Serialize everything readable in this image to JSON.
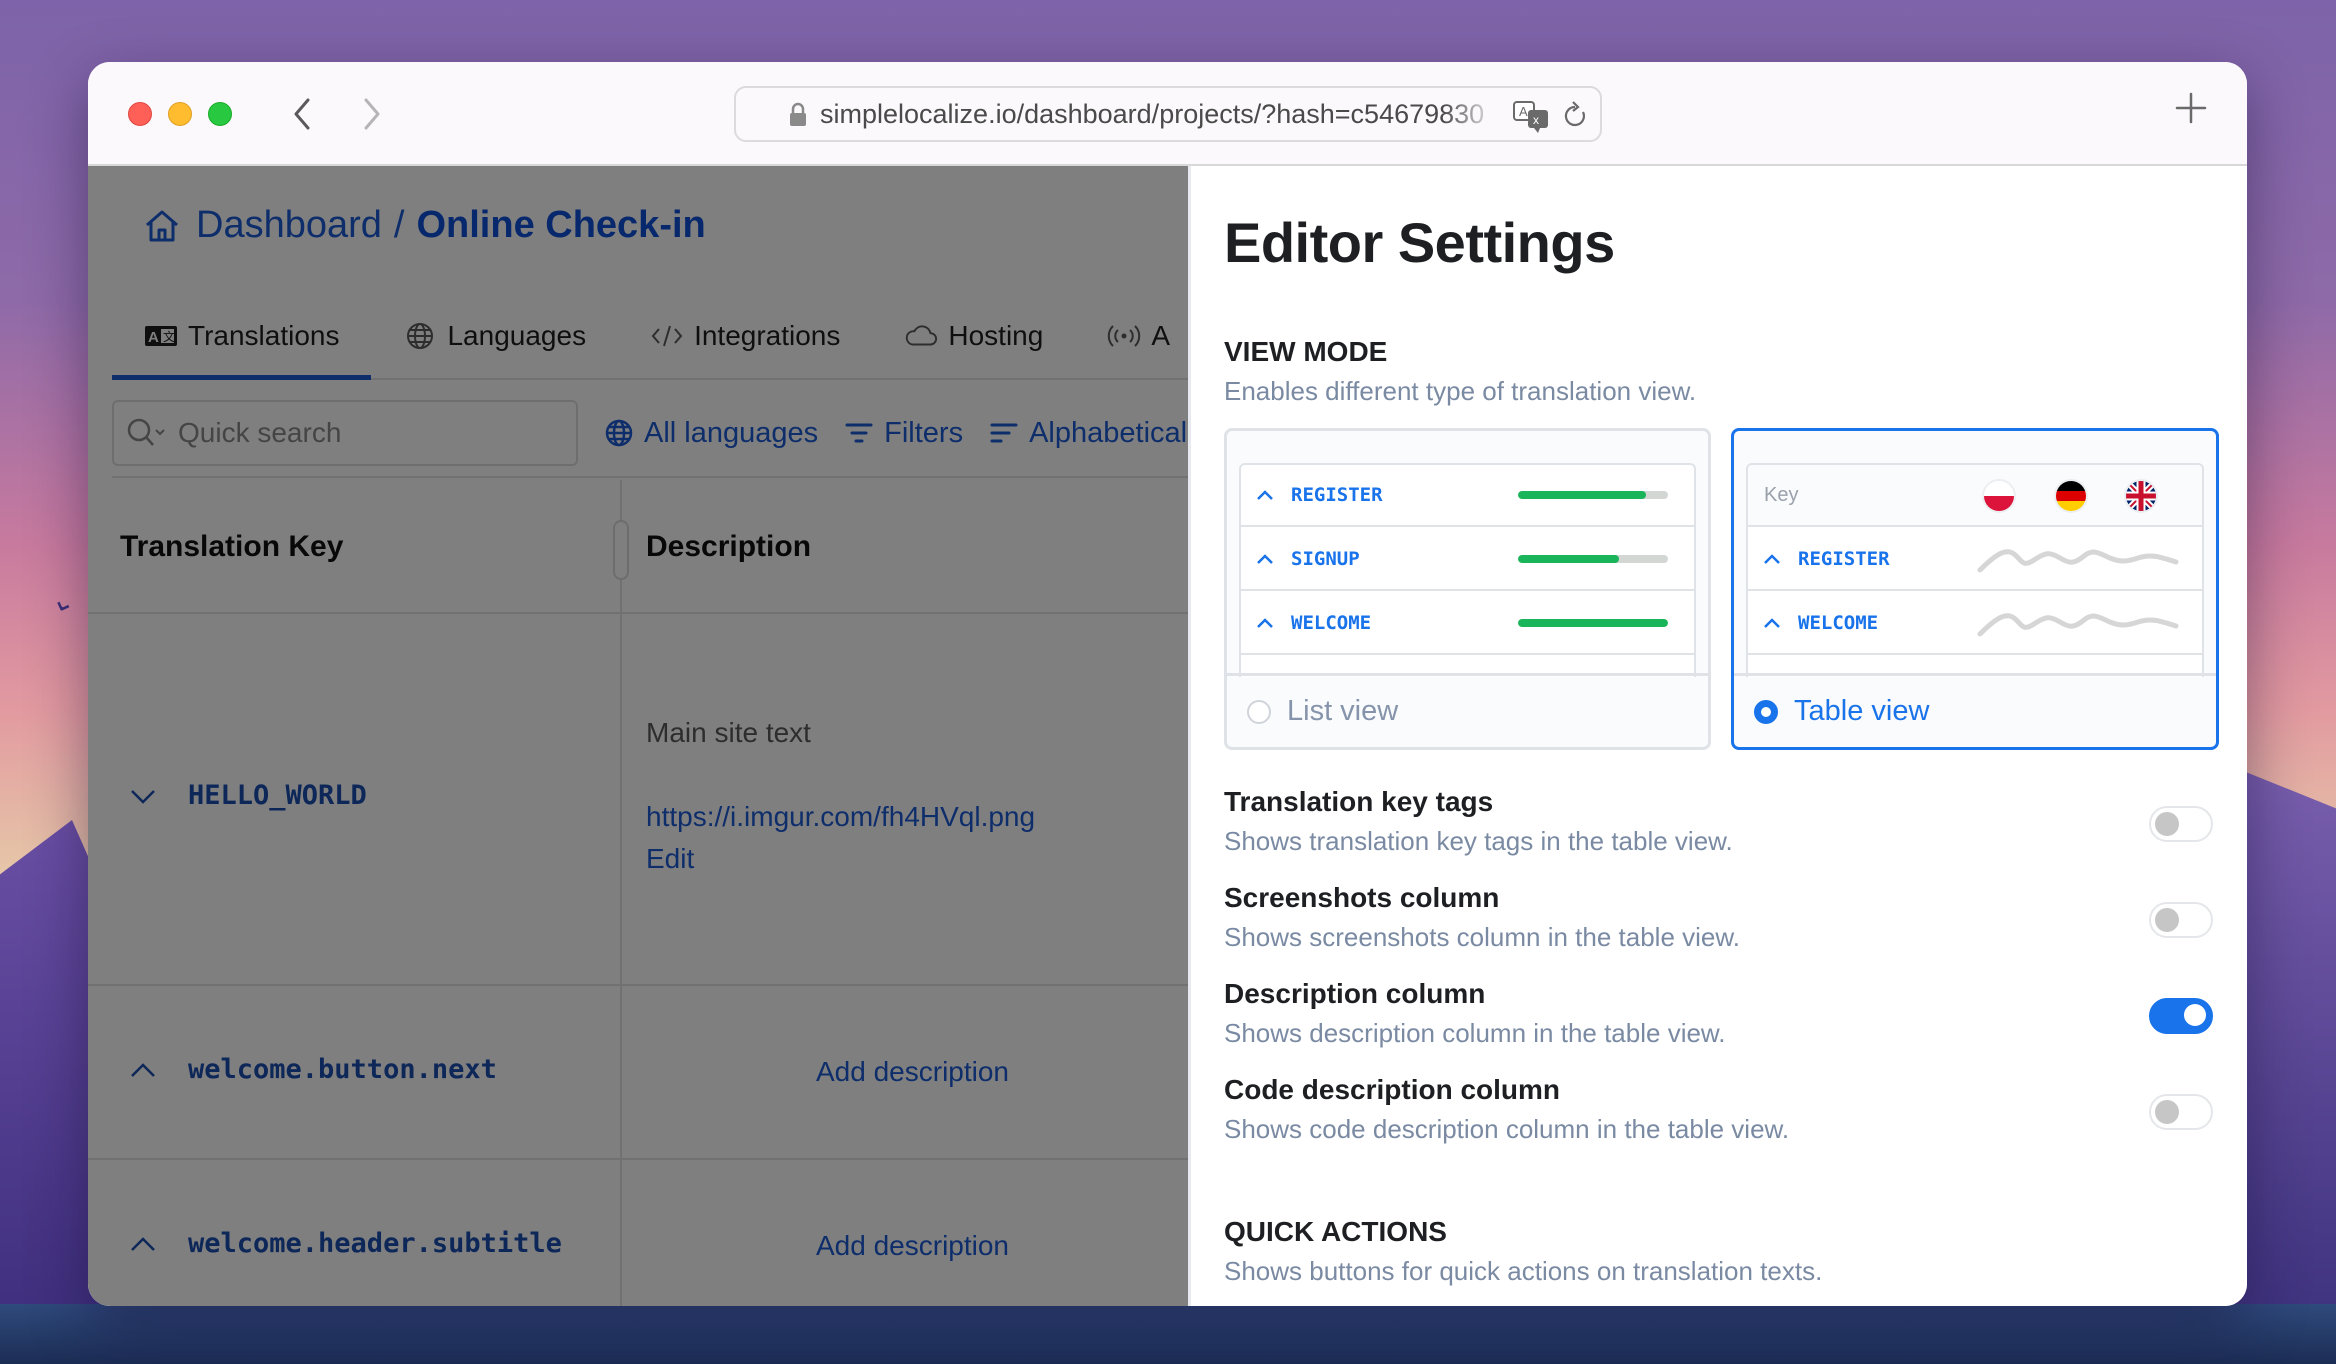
{
  "browser": {
    "url": "simplelocalize.io/dashboard/projects/?hash=c54679830",
    "back_label": "Back",
    "forward_label": "Forward",
    "new_tab_label": "New tab"
  },
  "breadcrumb": {
    "root": "Dashboard",
    "separator": "/",
    "current": "Online Check-in"
  },
  "tabs": [
    {
      "label": "Translations",
      "icon": "translate-icon",
      "active": true
    },
    {
      "label": "Languages",
      "icon": "globe-icon",
      "active": false
    },
    {
      "label": "Integrations",
      "icon": "code-icon",
      "active": false
    },
    {
      "label": "Hosting",
      "icon": "cloud-icon",
      "active": false
    },
    {
      "label": "A",
      "icon": "broadcast-icon",
      "active": false
    }
  ],
  "toolbar": {
    "search_placeholder": "Quick search",
    "languages_label": "All languages",
    "filters_label": "Filters",
    "sort_label": "Alphabetical"
  },
  "table": {
    "headers": {
      "key": "Translation Key",
      "description": "Description"
    },
    "rows": [
      {
        "key": "HELLO_WORLD",
        "expanded": true,
        "description": "Main site text",
        "link": "https://i.imgur.com/fh4HVql.png",
        "edit_label": "Edit"
      },
      {
        "key": "welcome.button.next",
        "expanded": false,
        "description_action": "Add description"
      },
      {
        "key": "welcome.header.subtitle",
        "expanded": false,
        "description_action": "Add description"
      }
    ]
  },
  "settings": {
    "title": "Editor Settings",
    "view_mode": {
      "title": "VIEW MODE",
      "subtitle": "Enables different type of translation view.",
      "options": [
        {
          "label": "List view",
          "selected": false,
          "preview_rows": [
            {
              "key": "REGISTER",
              "progress": 0.85
            },
            {
              "key": "SIGNUP",
              "progress": 0.67
            },
            {
              "key": "WELCOME",
              "progress": 1.0
            }
          ]
        },
        {
          "label": "Table view",
          "selected": true,
          "preview_header": "Key",
          "flags": [
            "pl",
            "de",
            "gb"
          ],
          "preview_rows": [
            {
              "key": "REGISTER"
            },
            {
              "key": "WELCOME"
            }
          ]
        }
      ]
    },
    "toggles": [
      {
        "title": "Translation key tags",
        "description": "Shows translation key tags in the table view.",
        "enabled": false
      },
      {
        "title": "Screenshots column",
        "description": "Shows screenshots column in the table view.",
        "enabled": false
      },
      {
        "title": "Description column",
        "description": "Shows description column in the table view.",
        "enabled": true
      },
      {
        "title": "Code description column",
        "description": "Shows code description column in the table view.",
        "enabled": false
      }
    ],
    "quick_actions": {
      "title": "QUICK ACTIONS",
      "subtitle": "Shows buttons for quick actions on translation texts."
    }
  },
  "colors": {
    "accent": "#1973ea",
    "link": "#1c5ad6",
    "progress": "#1ab45a",
    "muted": "#7a8aa3"
  }
}
